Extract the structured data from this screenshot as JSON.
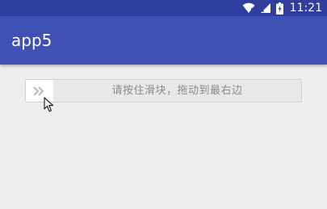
{
  "status_bar": {
    "time": "11:21",
    "icons": [
      "wifi-icon",
      "signal-icon",
      "battery-charging-icon"
    ],
    "background": "#303f9f"
  },
  "app_bar": {
    "title": "app5",
    "background": "#3f51b5"
  },
  "slide_verify": {
    "handle_icon": "double-chevron-right-icon",
    "hint": "请按住滑块，拖动到最右边",
    "progress": 0
  }
}
